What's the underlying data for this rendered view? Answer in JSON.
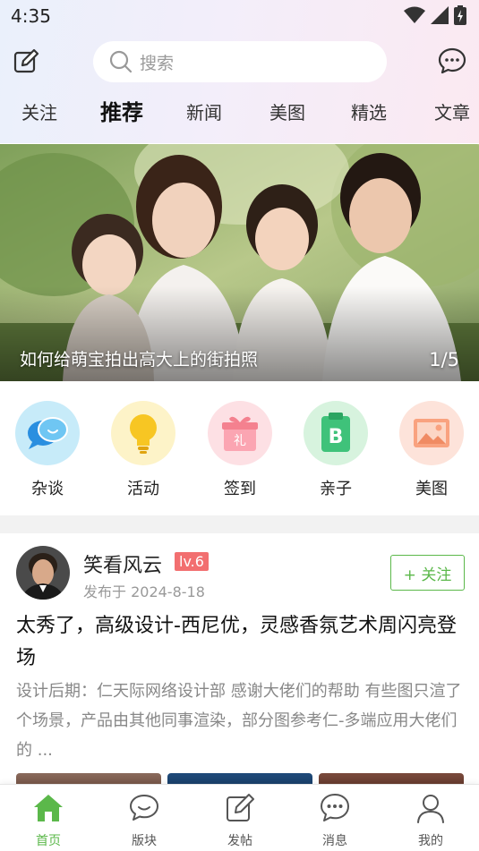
{
  "status_bar": {
    "time": "4:35"
  },
  "header": {
    "search_placeholder": "搜索"
  },
  "tabs": [
    {
      "label": "关注"
    },
    {
      "label": "推荐",
      "active": true
    },
    {
      "label": "新闻"
    },
    {
      "label": "美图"
    },
    {
      "label": "精选"
    },
    {
      "label": "文章"
    }
  ],
  "banner": {
    "caption": "如何给萌宝拍出高大上的街拍照",
    "index": "1/5"
  },
  "shortcuts": [
    {
      "label": "杂谈",
      "icon": "chat-bubbles-icon",
      "color": "#c7ebf9"
    },
    {
      "label": "活动",
      "icon": "lightbulb-icon",
      "color": "#fdf3c8"
    },
    {
      "label": "签到",
      "icon": "gift-icon",
      "color": "#fde0e4"
    },
    {
      "label": "亲子",
      "icon": "book-b-icon",
      "color": "#d7f3de"
    },
    {
      "label": "美图",
      "icon": "picture-icon",
      "color": "#fde3da"
    }
  ],
  "post": {
    "author": "笑看风云",
    "level": "lv.6",
    "date": "发布于 2024-8-18",
    "follow_label": "+ 关注",
    "title": "太秀了，高级设计-西尼优，灵感香氛艺术周闪亮登场",
    "excerpt": "设计后期：仁天际网络设计部 感谢大佬们的帮助 有些图只渲了个场景，产品由其他同事渲染，部分图参考仁-多端应用大佬们的 ..."
  },
  "bottom_nav": [
    {
      "label": "首页",
      "icon": "home-icon",
      "active": true
    },
    {
      "label": "版块",
      "icon": "chat-bubbles-icon"
    },
    {
      "label": "发帖",
      "icon": "edit-icon"
    },
    {
      "label": "消息",
      "icon": "message-icon"
    },
    {
      "label": "我的",
      "icon": "user-icon"
    }
  ],
  "colors": {
    "accent": "#5bb84a",
    "level_badge": "#f26f70"
  }
}
